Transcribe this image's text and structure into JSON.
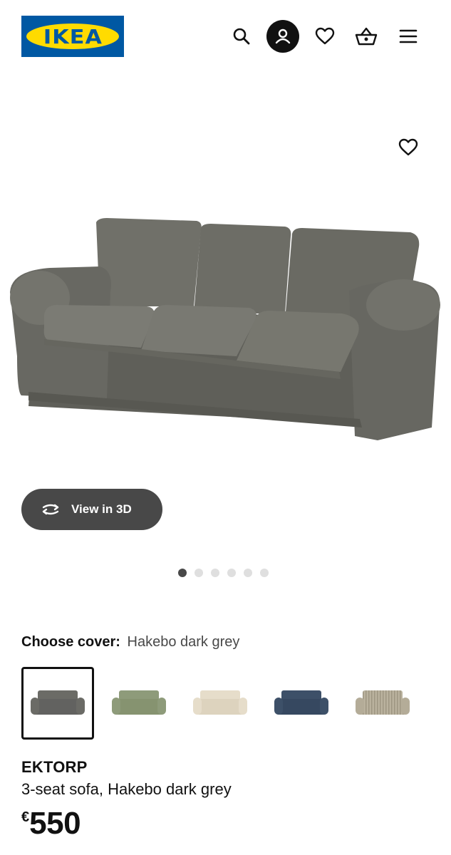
{
  "header": {
    "logo_text": "IKEA",
    "icons": [
      "search-icon",
      "account-icon",
      "heart-icon",
      "basket-icon",
      "menu-icon"
    ]
  },
  "gallery": {
    "favourite_icon": "heart-icon",
    "view3d_label": "View in 3D",
    "slides_total": 6,
    "active_slide": 1
  },
  "cover": {
    "label": "Choose cover:",
    "value": "Hakebo dark grey",
    "options": [
      {
        "color": "#6b6b66",
        "selected": true
      },
      {
        "color": "#8e9b7a",
        "selected": false
      },
      {
        "color": "#e6ddca",
        "selected": false
      },
      {
        "color": "#3d5068",
        "selected": false
      },
      {
        "color": "#b4ac98",
        "selected": false,
        "striped": true
      }
    ]
  },
  "product": {
    "name": "EKTORP",
    "description": "3-seat sofa, Hakebo dark grey",
    "currency": "€",
    "price": "550"
  },
  "colors": {
    "brand_blue": "#0058a3",
    "brand_yellow": "#ffdb00",
    "sofa": "#6b6b66",
    "button_dark": "#484848"
  }
}
